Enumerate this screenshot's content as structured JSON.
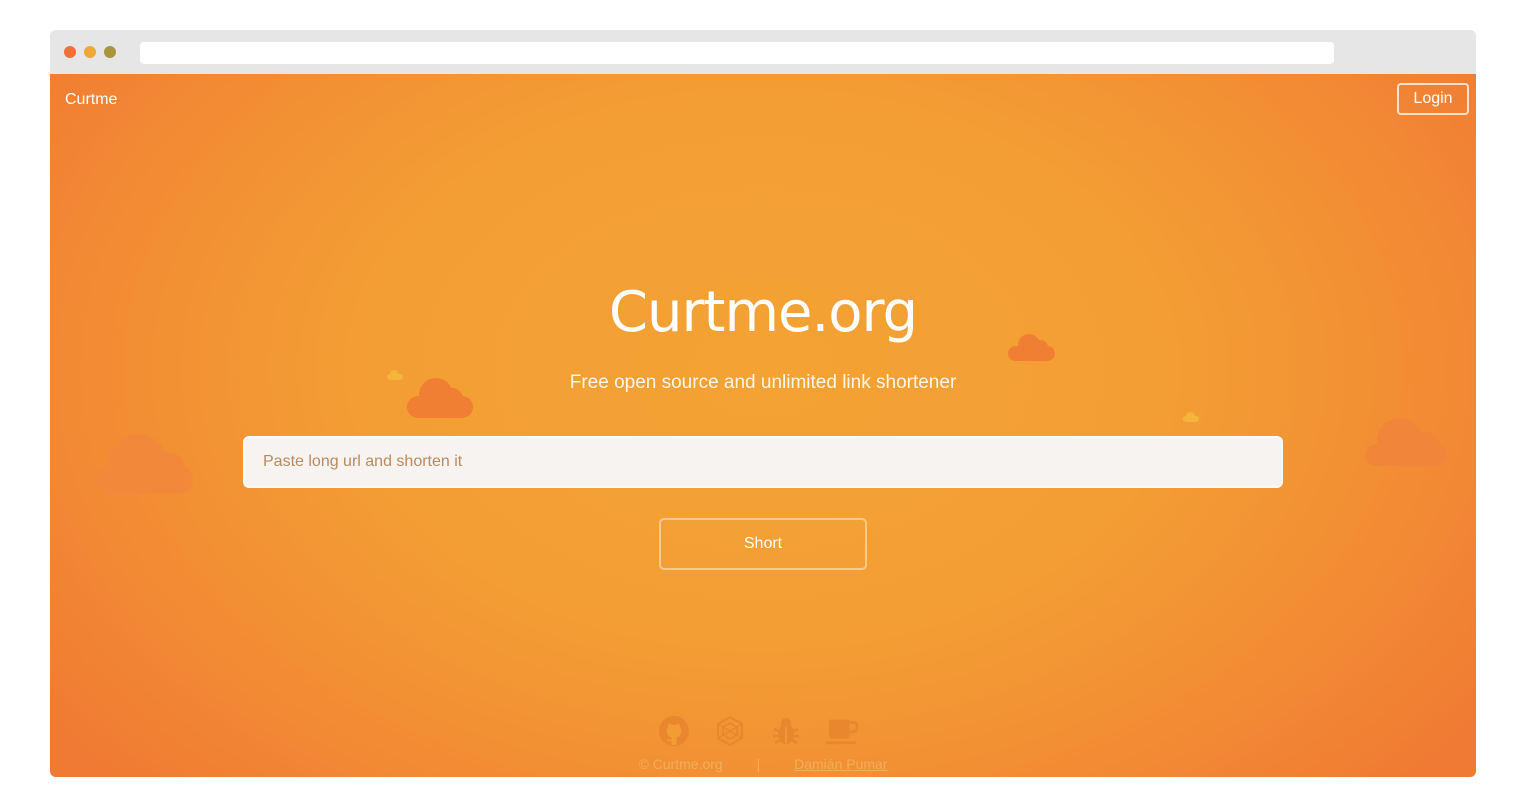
{
  "header": {
    "brand": "Curtme",
    "login_label": "Login"
  },
  "hero": {
    "title": "Curtme.org",
    "subtitle": "Free open source and unlimited link shortener"
  },
  "form": {
    "url_placeholder": "Paste long url and shorten it",
    "url_value": "",
    "submit_label": "Short"
  },
  "footer": {
    "icons": [
      "github-icon",
      "hexagon-icon",
      "bug-icon",
      "coffee-icon"
    ],
    "copyright": "© Curtme.org",
    "separator": "|",
    "author": "Damián Pumar"
  },
  "colors": {
    "background_center": "#f3a233",
    "background_edge": "#f07a33",
    "icon": "#e8872e",
    "cloud": "#f07f34"
  }
}
